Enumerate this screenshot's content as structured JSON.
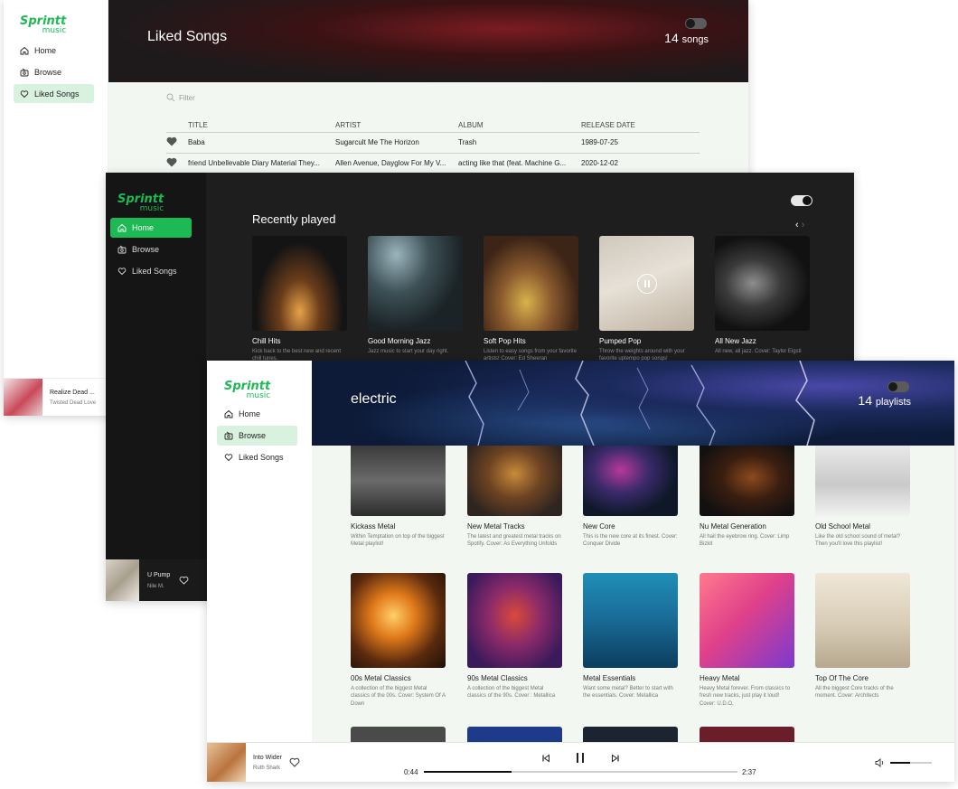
{
  "brand": {
    "name": "Sprintt",
    "sub": "music",
    "color": "#1db954"
  },
  "nav": [
    {
      "label": "Home",
      "icon": "home-icon"
    },
    {
      "label": "Browse",
      "icon": "radio-icon"
    },
    {
      "label": "Liked Songs",
      "icon": "heart-icon"
    }
  ],
  "liked": {
    "title": "Liked Songs",
    "count": "14",
    "count_unit": "songs",
    "filter_placeholder": "Filter",
    "columns": [
      "TITLE",
      "ARTIST",
      "ALBUM",
      "RELEASE DATE"
    ],
    "rows": [
      {
        "title": "Baba",
        "artist": "Sugarcult Me The Horizon",
        "album": "Trash",
        "date": "1989-07-25"
      },
      {
        "title": "friend Unbellevable Diary Material They...",
        "artist": "Allen Avenue, Dayglow For My V...",
        "album": "acting like that (feat. Machine G...",
        "date": "2020-12-02"
      }
    ],
    "now_playing": {
      "title": "Realize Dead ...",
      "artist": "Twisted Dead Love"
    }
  },
  "recent": {
    "title": "Recently played",
    "cards": [
      {
        "name": "Chill Hits",
        "desc": "Kick back to the best new and recent chill tunes."
      },
      {
        "name": "Good Morning Jazz",
        "desc": "Jazz music to start your day right."
      },
      {
        "name": "Soft Pop Hits",
        "desc": "Listen to easy songs from your favorite artists! Cover: Ed Sheeran"
      },
      {
        "name": "Pumped Pop",
        "desc": "Throw the weights around with your favorite uptempo pop songs!"
      },
      {
        "name": "All New Jazz",
        "desc": "All new, all jazz. Cover: Taylor Eigsti"
      }
    ],
    "now_playing": {
      "title": "U Pump",
      "artist": "Nile M."
    }
  },
  "genre": {
    "title": "electric",
    "count": "14",
    "count_unit": "playlists",
    "cards": [
      {
        "name": "Kickass Metal",
        "desc": "Within Temptation on top of the biggest Metal playlist!"
      },
      {
        "name": "New Metal Tracks",
        "desc": "The latest and greatest metal tracks on Spotify. Cover: As Everything Unfolds"
      },
      {
        "name": "New Core",
        "desc": "This is the new core at its finest. Cover: Conquer Divide"
      },
      {
        "name": "Nu Metal Generation",
        "desc": "All hail the eyebrow ring. Cover: Limp Bizkit"
      },
      {
        "name": "Old School Metal",
        "desc": "Like the old school sound of metal? Then you'll love this playlist!"
      },
      {
        "name": "00s Metal Classics",
        "desc": "A collection of the biggest Metal classics of the 00s. Cover: System Of A Down"
      },
      {
        "name": "90s Metal Classics",
        "desc": "A collection of the biggest Metal classics of the 90s. Cover : Metallica"
      },
      {
        "name": "Metal Essentials",
        "desc": "Want some metal? Better to start with the essentials. Cover: Metallica"
      },
      {
        "name": "Heavy Metal",
        "desc": "Heavy Metal forever. From classics to fresh new tracks, just play it loud! Cover: U.D.O."
      },
      {
        "name": "Top Of The Core",
        "desc": "All the biggest Core tracks of the moment. Cover: Architects"
      }
    ],
    "player": {
      "title": "Into Wider",
      "artist": "Ruth Shark",
      "elapsed": "0:44",
      "duration": "2:37",
      "progress": 0.28,
      "volume": 0.48
    }
  }
}
